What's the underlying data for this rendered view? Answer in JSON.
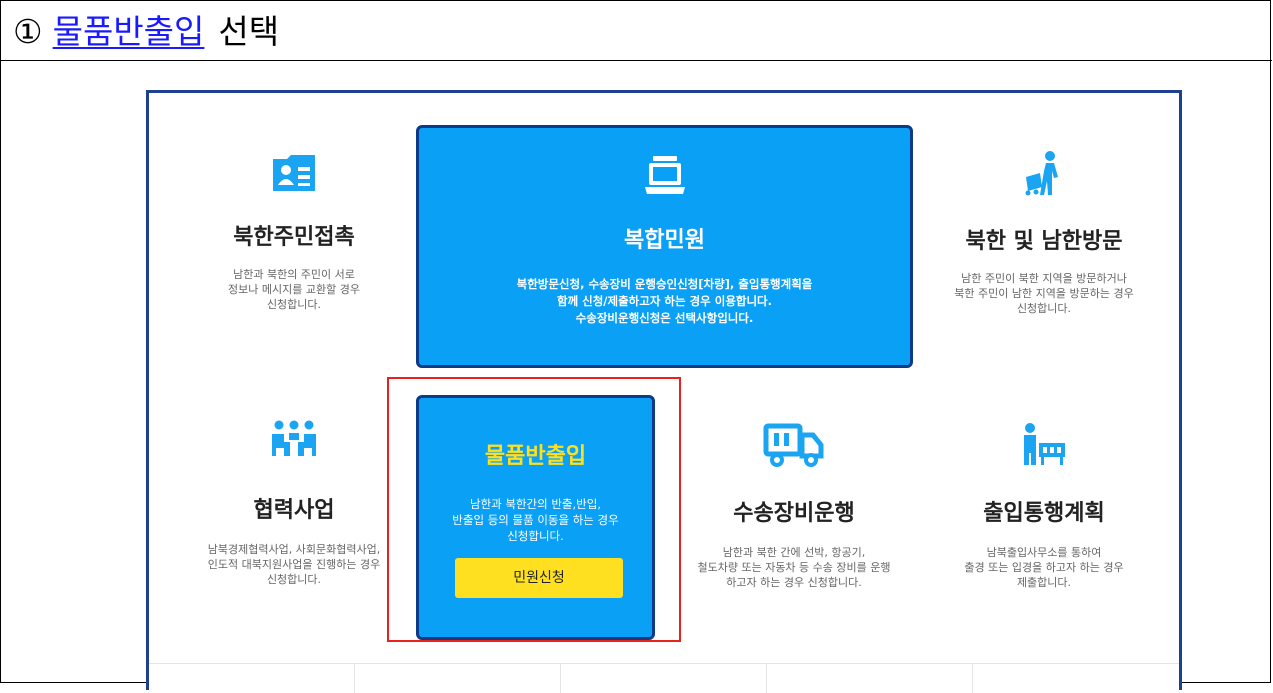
{
  "doc": {
    "step": "①",
    "highlight": "물품반출입",
    "suffix": "선택"
  },
  "services": {
    "contact": {
      "title": "북한주민접촉",
      "desc1": "남한과 북한의 주민이 서로",
      "desc2": "정보나 메시지를 교환할 경우",
      "desc3": "신청합니다."
    },
    "complex": {
      "title": "복합민원",
      "desc1": "북한방문신청, 수송장비 운행승인신청[차량], 출입통행계획을",
      "desc2": "함께 신청/제출하고자 하는 경우 이용합니다.",
      "desc3": "수송장비운행신청은 선택사항입니다."
    },
    "visit": {
      "title": "북한 및 남한방문",
      "desc1": "남한 주민이 북한 지역을 방문하거나",
      "desc2": "북한 주민이 남한 지역을 방문하는 경우",
      "desc3": "신청합니다."
    },
    "cooperation": {
      "title": "협력사업",
      "desc1": "남북경제협력사업, 사회문화협력사업,",
      "desc2": "인도적 대북지원사업을 진행하는 경우",
      "desc3": "신청합니다."
    },
    "goods": {
      "title": "물품반출입",
      "desc1": "남한과 북한간의 반출,반입,",
      "desc2": "반출입 등의 물품 이동을 하는 경우",
      "desc3": "신청합니다.",
      "button": "민원신청"
    },
    "transport": {
      "title": "수송장비운행",
      "desc1": "남한과 북한 간에 선박, 항공기,",
      "desc2": "철도차량 또는 자동차 등 수송 장비를 운행",
      "desc3": "하고자 하는 경우 신청합니다."
    },
    "passage": {
      "title": "출입통행계획",
      "desc1": "남북출입사무소를 통하여",
      "desc2": "출경 또는 입경을 하고자 하는 경우",
      "desc3": "제출합니다."
    }
  },
  "icons": {
    "contact": "id-card-icon",
    "complex": "laptop-icon",
    "visit": "traveler-icon",
    "cooperation": "group-icon",
    "transport": "truck-icon",
    "passage": "cart-person-icon"
  },
  "colors": {
    "primary": "#0aa0f5",
    "border": "#0d3a86",
    "button": "#ffe020",
    "goods_title": "#ffe020",
    "highlight_box": "#e8201e",
    "title_link": "#1a1aff"
  }
}
